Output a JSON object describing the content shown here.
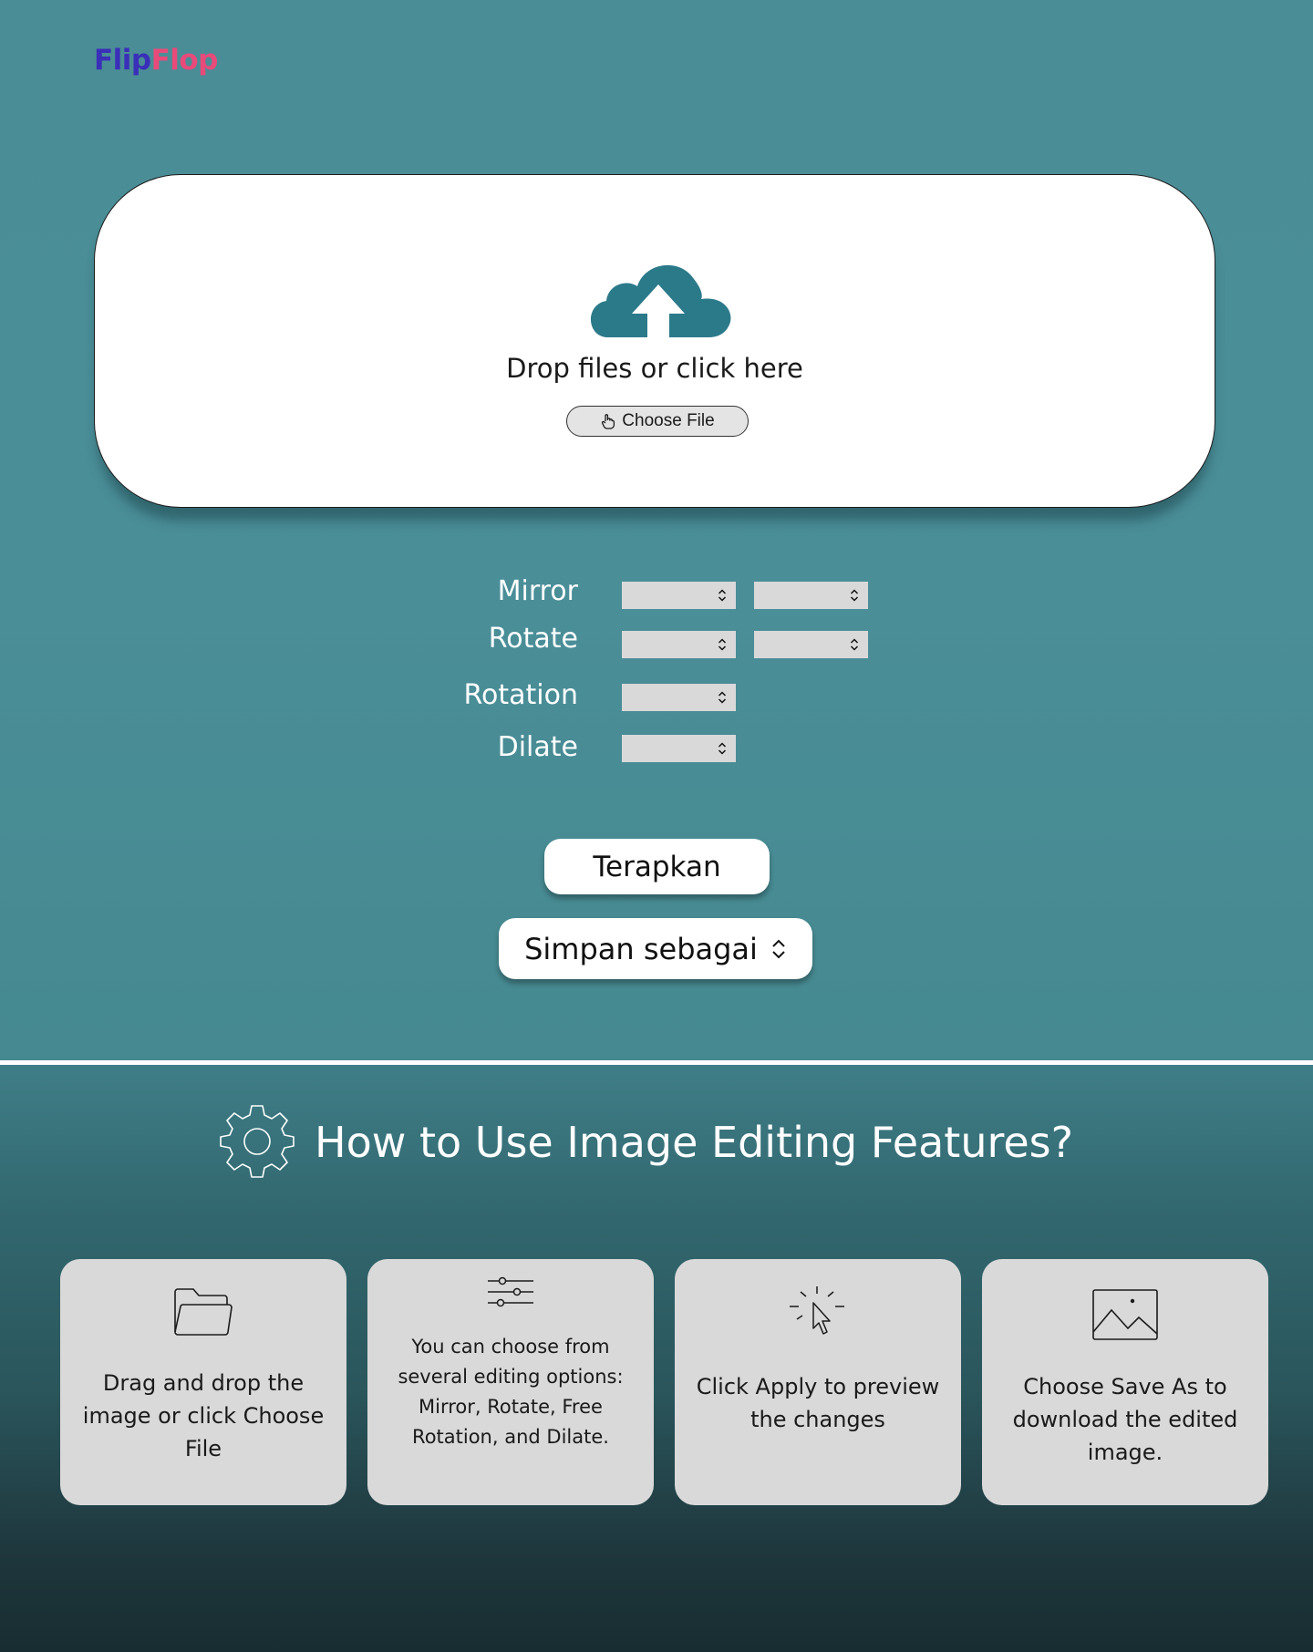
{
  "app": {
    "logo_part1": "Flip",
    "logo_part2": "Flop",
    "colors": {
      "logo_flip": "#3a2fb8",
      "logo_flop": "#e84a7a",
      "accent": "#2b7a8a"
    }
  },
  "upload": {
    "icon": "cloud-upload-icon",
    "prompt": "Drop files or click here",
    "choose_file_label": "Choose File",
    "choose_file_icon": "hand-pointer-icon"
  },
  "options": {
    "mirror_label": "Mirror",
    "rotate_label": "Rotate",
    "rotation_label": "Rotation",
    "dilate_label": "Dilate"
  },
  "actions": {
    "apply_label": "Terapkan",
    "save_as_label": "Simpan sebagai"
  },
  "howto": {
    "icon": "gear-icon",
    "title": "How to Use Image Editing Features?",
    "cards": [
      {
        "icon": "folder-icon",
        "text": "Drag and drop the image or click Choose File"
      },
      {
        "icon": "sliders-icon",
        "text": "You can choose from several editing options: Mirror, Rotate, Free Rotation, and Dilate."
      },
      {
        "icon": "click-cursor-icon",
        "text": "Click Apply to preview the changes"
      },
      {
        "icon": "image-icon",
        "text": "Choose Save As to download the edited image."
      }
    ]
  }
}
